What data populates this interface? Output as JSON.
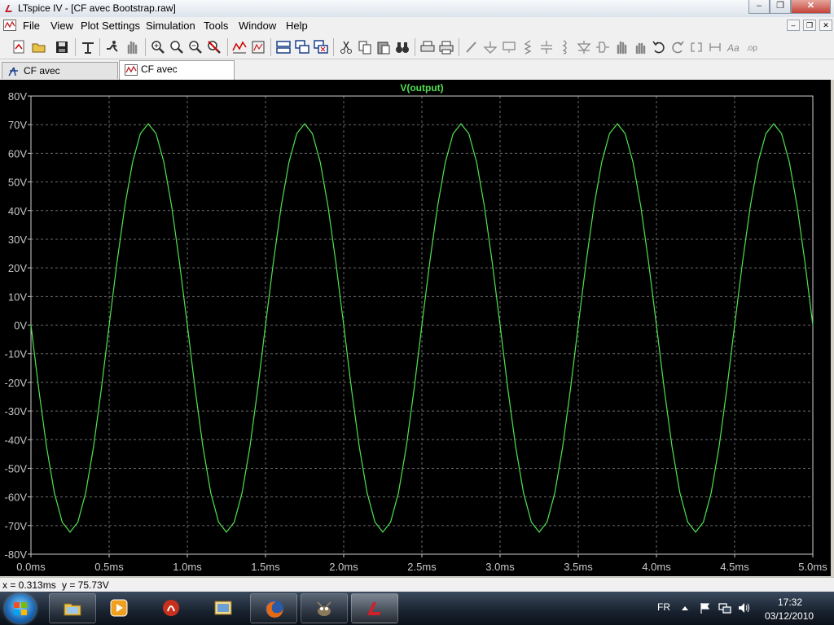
{
  "window": {
    "title": "LTspice IV - [CF avec Bootstrap.raw]",
    "controls": {
      "minimize": "–",
      "restore": "❐",
      "close": "✕"
    }
  },
  "menu": {
    "items": [
      {
        "label": "File"
      },
      {
        "label": "View"
      },
      {
        "label": "Plot Settings"
      },
      {
        "label": "Simulation"
      },
      {
        "label": "Tools"
      },
      {
        "label": "Window"
      },
      {
        "label": "Help"
      }
    ],
    "mdi_controls": {
      "minimize": "–",
      "restore": "❐",
      "close": "✕"
    }
  },
  "toolbar": {
    "icons": [
      "new-schematic-icon",
      "open-icon",
      "save-icon",
      "control-panel-icon",
      "run-icon",
      "pan-icon",
      "zoom-in-icon",
      "zoom-box-icon",
      "zoom-out-icon",
      "zoom-cancel-icon",
      "autorange-icon",
      "zoom-fit-icon",
      "tile-horizontal-icon",
      "cascade-icon",
      "close-window-icon",
      "cut-icon",
      "copy-icon",
      "paste-icon",
      "find-icon",
      "print-setup-icon",
      "print-icon",
      "wire-icon",
      "ground-icon",
      "label-icon",
      "resistor-icon",
      "capacitor-icon",
      "inductor-icon",
      "diode-icon",
      "component-icon",
      "move-icon",
      "drag-icon",
      "undo-icon",
      "redo-icon",
      "rotate-icon",
      "mirror-icon",
      "text-icon",
      "spice-directive-icon"
    ]
  },
  "tabs": [
    {
      "label": "CF avec Bootstrap.asc",
      "icon": "schematic-icon",
      "active": false
    },
    {
      "label": "CF avec Bootstrap.raw",
      "icon": "waveform-icon",
      "active": true
    }
  ],
  "status": {
    "x_readout": "x = 0.313ms",
    "y_readout": "y = 75.73V"
  },
  "taskbar": {
    "apps": [
      "explorer-icon",
      "media-player-icon",
      "app-icon",
      "file-manager-icon",
      "firefox-icon",
      "gimp-icon",
      "ltspice-icon"
    ],
    "language": "FR",
    "time": "17:32",
    "date": "03/12/2010"
  },
  "colors": {
    "plot_background": "#000000",
    "trace": "#4fe34f",
    "grid": "#6a6a6a",
    "axis_text": "#c8c8c8"
  },
  "chart_data": {
    "type": "line",
    "title": "V(output)",
    "xlabel": "",
    "ylabel": "",
    "xlim": [
      0,
      5
    ],
    "ylim": [
      -80,
      80
    ],
    "x_unit": "ms",
    "y_unit": "V",
    "grid": true,
    "legend": "none",
    "x_ticks": [
      "0.0ms",
      "0.5ms",
      "1.0ms",
      "1.5ms",
      "2.0ms",
      "2.5ms",
      "3.0ms",
      "3.5ms",
      "4.0ms",
      "4.5ms",
      "5.0ms"
    ],
    "y_ticks": [
      "80V",
      "70V",
      "60V",
      "50V",
      "40V",
      "30V",
      "20V",
      "10V",
      "0V",
      "-10V",
      "-20V",
      "-30V",
      "-40V",
      "-50V",
      "-60V",
      "-70V",
      "-80V"
    ],
    "series": [
      {
        "name": "V(output)",
        "x": [
          0,
          0.05,
          0.1,
          0.15,
          0.2,
          0.25,
          0.3,
          0.35,
          0.4,
          0.45,
          0.5,
          0.55,
          0.6,
          0.65,
          0.7,
          0.75,
          0.8,
          0.85,
          0.9,
          0.95,
          1.0,
          1.05,
          1.1,
          1.15,
          1.2,
          1.25,
          1.3,
          1.35,
          1.4,
          1.45,
          1.5,
          1.55,
          1.6,
          1.65,
          1.7,
          1.75,
          1.8,
          1.85,
          1.9,
          1.95,
          2.0,
          2.05,
          2.1,
          2.15,
          2.2,
          2.25,
          2.3,
          2.35,
          2.4,
          2.45,
          2.5,
          2.55,
          2.6,
          2.65,
          2.7,
          2.75,
          2.8,
          2.85,
          2.9,
          2.95,
          3.0,
          3.05,
          3.1,
          3.15,
          3.2,
          3.25,
          3.3,
          3.35,
          3.4,
          3.45,
          3.5,
          3.55,
          3.6,
          3.65,
          3.7,
          3.75,
          3.8,
          3.85,
          3.9,
          3.95,
          4.0,
          4.05,
          4.1,
          4.15,
          4.2,
          4.25,
          4.3,
          4.35,
          4.4,
          4.45,
          4.5,
          4.55,
          4.6,
          4.65,
          4.7,
          4.75,
          4.8,
          4.85,
          4.9,
          4.95,
          5.0
        ],
        "y": [
          0,
          -22.4,
          -42.6,
          -58.6,
          -68.8,
          -72.3,
          -68.8,
          -58.6,
          -42.6,
          -22.4,
          0,
          21.8,
          41.4,
          56.9,
          66.9,
          70.3,
          66.9,
          56.9,
          41.4,
          21.8,
          0,
          -22.4,
          -42.6,
          -58.6,
          -68.8,
          -72.3,
          -68.8,
          -58.6,
          -42.6,
          -22.4,
          0,
          21.8,
          41.4,
          56.9,
          66.9,
          70.3,
          66.9,
          56.9,
          41.4,
          21.8,
          0,
          -22.4,
          -42.6,
          -58.6,
          -68.8,
          -72.3,
          -68.8,
          -58.6,
          -42.6,
          -22.4,
          0,
          21.8,
          41.4,
          56.9,
          66.9,
          70.3,
          66.9,
          56.9,
          41.4,
          21.8,
          0,
          -22.4,
          -42.6,
          -58.6,
          -68.8,
          -72.3,
          -68.8,
          -58.6,
          -42.6,
          -22.4,
          0,
          21.8,
          41.4,
          56.9,
          66.9,
          70.3,
          66.9,
          56.9,
          41.4,
          21.8,
          0,
          -22.4,
          -42.6,
          -58.6,
          -68.8,
          -72.3,
          -68.8,
          -58.6,
          -42.6,
          -22.4,
          0,
          21.8,
          41.4,
          56.9,
          66.9,
          70.3,
          66.9,
          56.9,
          41.4,
          21.8,
          0
        ]
      }
    ]
  }
}
